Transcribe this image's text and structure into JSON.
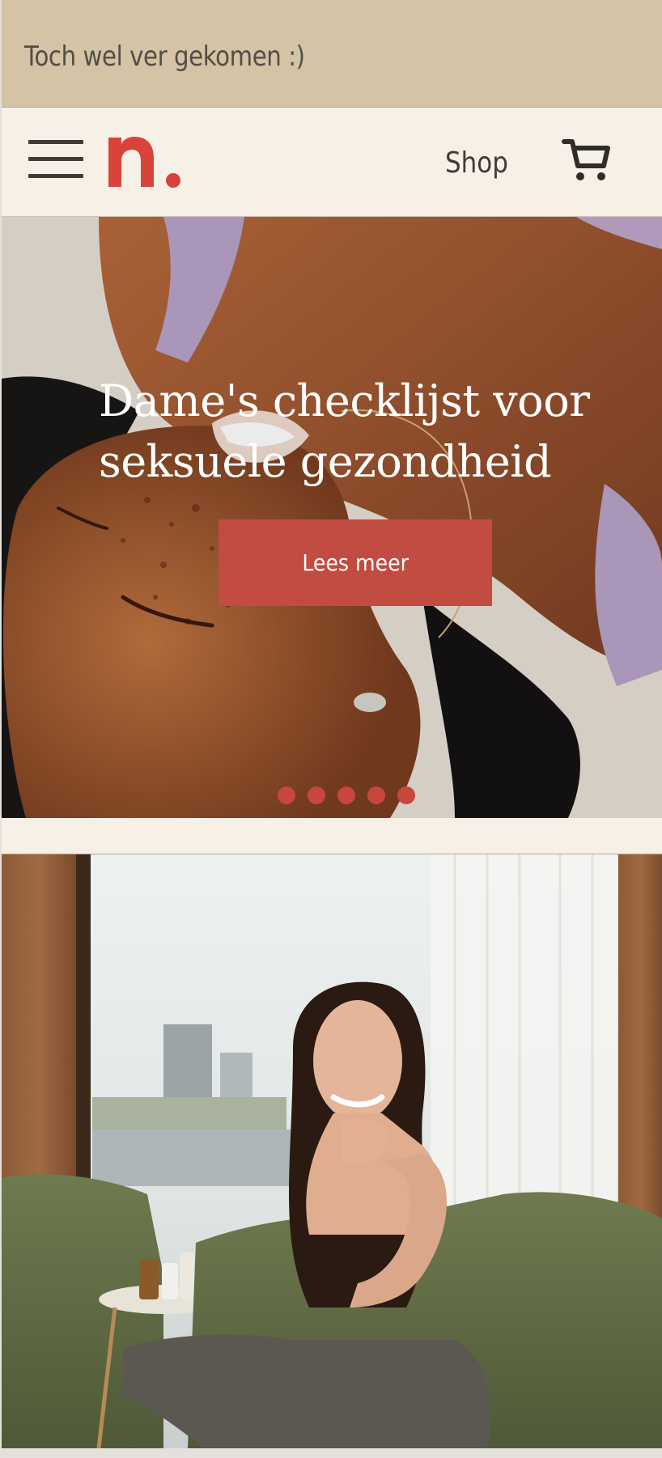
{
  "announcement": {
    "text": "Toch wel ver gekomen :)"
  },
  "header": {
    "logo_alt": "n.",
    "shop_label": "Shop",
    "menu_icon": "hamburger-menu-icon",
    "cart_icon": "shopping-cart-icon"
  },
  "hero": {
    "title": "Dame's checklijst voor seksuele gezondheid",
    "cta_label": "Lees meer",
    "slide_count": 5
  },
  "colors": {
    "announcement_bg": "#d4c3a4",
    "header_bg": "#f7f0e6",
    "brand_red": "#c24c41",
    "text_dark": "#3f3b36"
  }
}
